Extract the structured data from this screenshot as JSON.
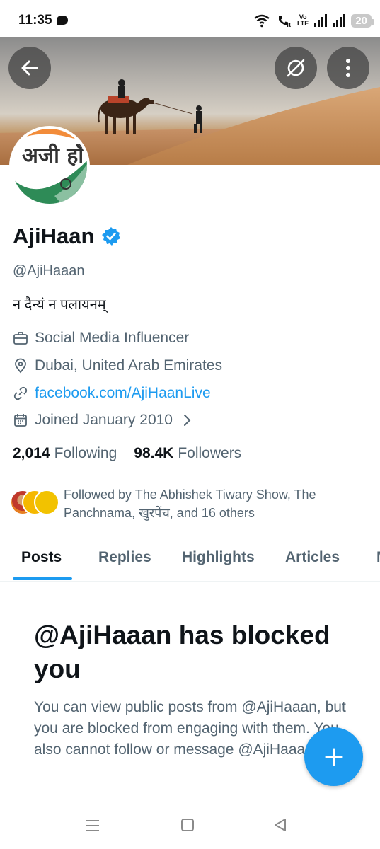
{
  "status_bar": {
    "time": "11:35",
    "network": "Vo LTE",
    "battery": "20"
  },
  "header": {
    "back_icon": "arrow-left-icon",
    "grok_icon": "grok-icon",
    "more_icon": "more-vertical-icon"
  },
  "profile": {
    "display_name": "AjiHaan",
    "verified": true,
    "handle": "@AjiHaaan",
    "bio": "न दैन्यं न पलायनम्",
    "category": "Social Media Influencer",
    "location": "Dubai, United Arab Emirates",
    "website": "facebook.com/AjiHaanLive",
    "joined": "Joined January 2010",
    "following_count": "2,014",
    "following_label": "Following",
    "followers_count": "98.4K",
    "followers_label": "Followers",
    "followed_by": "Followed by The Abhishek Tiwary Show, The Panchnama, खुरपेंच, and 16 others",
    "avatar_text": "अजी हाँ"
  },
  "tabs": [
    "Posts",
    "Replies",
    "Highlights",
    "Articles",
    "M"
  ],
  "active_tab": "Posts",
  "blocked": {
    "title": "@AjiHaaan has blocked you",
    "body": "You can view public posts from @AjiHaaan, but you are blocked from engaging with them. You also cannot follow or message @AjiHaaan."
  },
  "colors": {
    "accent": "#1d9bf0",
    "text_primary": "#0f1419",
    "text_secondary": "#536471"
  }
}
